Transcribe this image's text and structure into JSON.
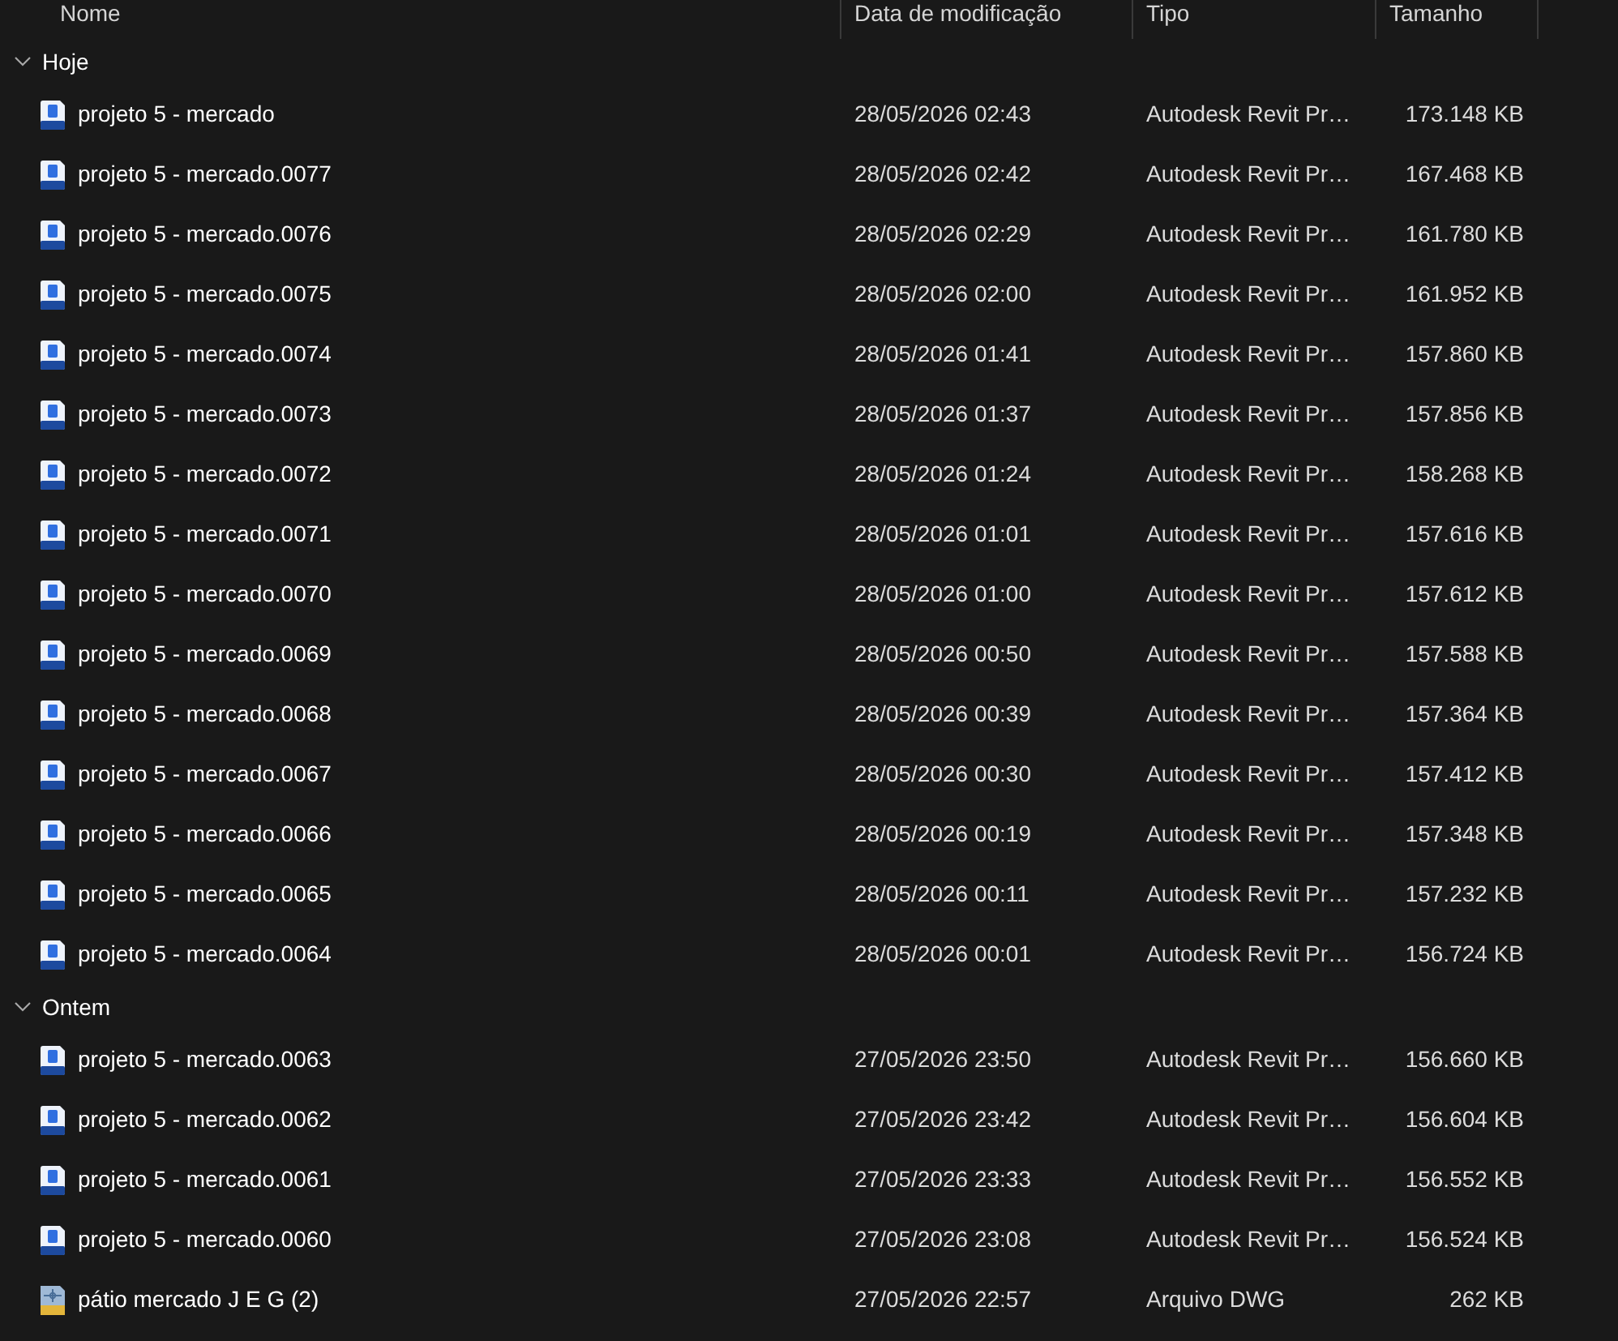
{
  "columns": [
    {
      "label": "Nome"
    },
    {
      "label": "Data de modificação"
    },
    {
      "label": "Tipo"
    },
    {
      "label": "Tamanho"
    }
  ],
  "groups": [
    {
      "label": "Hoje",
      "expanded": true,
      "files": [
        {
          "kind": "rvt",
          "name": "projeto 5 - mercado",
          "modified": "28/05/2026 02:43",
          "type": "Autodesk Revit Pr…",
          "size": "173.148 KB"
        },
        {
          "kind": "rvt",
          "name": "projeto 5 - mercado.0077",
          "modified": "28/05/2026 02:42",
          "type": "Autodesk Revit Pr…",
          "size": "167.468 KB"
        },
        {
          "kind": "rvt",
          "name": "projeto 5 - mercado.0076",
          "modified": "28/05/2026 02:29",
          "type": "Autodesk Revit Pr…",
          "size": "161.780 KB"
        },
        {
          "kind": "rvt",
          "name": "projeto 5 - mercado.0075",
          "modified": "28/05/2026 02:00",
          "type": "Autodesk Revit Pr…",
          "size": "161.952 KB"
        },
        {
          "kind": "rvt",
          "name": "projeto 5 - mercado.0074",
          "modified": "28/05/2026 01:41",
          "type": "Autodesk Revit Pr…",
          "size": "157.860 KB"
        },
        {
          "kind": "rvt",
          "name": "projeto 5 - mercado.0073",
          "modified": "28/05/2026 01:37",
          "type": "Autodesk Revit Pr…",
          "size": "157.856 KB"
        },
        {
          "kind": "rvt",
          "name": "projeto 5 - mercado.0072",
          "modified": "28/05/2026 01:24",
          "type": "Autodesk Revit Pr…",
          "size": "158.268 KB"
        },
        {
          "kind": "rvt",
          "name": "projeto 5 - mercado.0071",
          "modified": "28/05/2026 01:01",
          "type": "Autodesk Revit Pr…",
          "size": "157.616 KB"
        },
        {
          "kind": "rvt",
          "name": "projeto 5 - mercado.0070",
          "modified": "28/05/2026 01:00",
          "type": "Autodesk Revit Pr…",
          "size": "157.612 KB"
        },
        {
          "kind": "rvt",
          "name": "projeto 5 - mercado.0069",
          "modified": "28/05/2026 00:50",
          "type": "Autodesk Revit Pr…",
          "size": "157.588 KB"
        },
        {
          "kind": "rvt",
          "name": "projeto 5 - mercado.0068",
          "modified": "28/05/2026 00:39",
          "type": "Autodesk Revit Pr…",
          "size": "157.364 KB"
        },
        {
          "kind": "rvt",
          "name": "projeto 5 - mercado.0067",
          "modified": "28/05/2026 00:30",
          "type": "Autodesk Revit Pr…",
          "size": "157.412 KB"
        },
        {
          "kind": "rvt",
          "name": "projeto 5 - mercado.0066",
          "modified": "28/05/2026 00:19",
          "type": "Autodesk Revit Pr…",
          "size": "157.348 KB"
        },
        {
          "kind": "rvt",
          "name": "projeto 5 - mercado.0065",
          "modified": "28/05/2026 00:11",
          "type": "Autodesk Revit Pr…",
          "size": "157.232 KB"
        },
        {
          "kind": "rvt",
          "name": "projeto 5 - mercado.0064",
          "modified": "28/05/2026 00:01",
          "type": "Autodesk Revit Pr…",
          "size": "156.724 KB"
        }
      ]
    },
    {
      "label": "Ontem",
      "expanded": true,
      "files": [
        {
          "kind": "rvt",
          "name": "projeto 5 - mercado.0063",
          "modified": "27/05/2026 23:50",
          "type": "Autodesk Revit Pr…",
          "size": "156.660 KB"
        },
        {
          "kind": "rvt",
          "name": "projeto 5 - mercado.0062",
          "modified": "27/05/2026 23:42",
          "type": "Autodesk Revit Pr…",
          "size": "156.604 KB"
        },
        {
          "kind": "rvt",
          "name": "projeto 5 - mercado.0061",
          "modified": "27/05/2026 23:33",
          "type": "Autodesk Revit Pr…",
          "size": "156.552 KB"
        },
        {
          "kind": "rvt",
          "name": "projeto 5 - mercado.0060",
          "modified": "27/05/2026 23:08",
          "type": "Autodesk Revit Pr…",
          "size": "156.524 KB"
        },
        {
          "kind": "dwg",
          "name": "pátio mercado J E G (2)",
          "modified": "27/05/2026 22:57",
          "type": "Arquivo DWG",
          "size": "262 KB"
        }
      ]
    }
  ]
}
